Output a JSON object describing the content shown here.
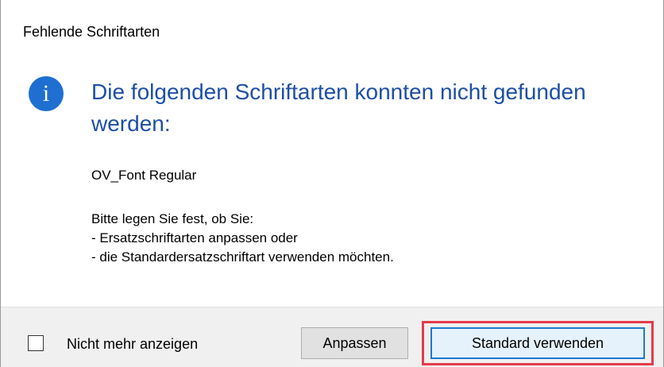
{
  "dialog": {
    "title": "Fehlende Schriftarten",
    "icon": "info-icon",
    "icon_glyph": "i",
    "headline": "Die folgenden Schriftarten konnten nicht gefunden werden:",
    "font_name": "OV_Font Regular",
    "instructions": [
      "Bitte legen Sie fest, ob Sie:",
      "- Ersatzschriftarten anpassen oder",
      "- die Standardersatzschriftart verwenden möchten."
    ]
  },
  "footer": {
    "checkbox_label": "Nicht mehr anzeigen",
    "checkbox_checked": false,
    "buttons": {
      "anpassen": "Anpassen",
      "standard": "Standard verwenden"
    }
  },
  "colors": {
    "accent": "#1f6fd1",
    "headline": "#1e4fa6",
    "highlight": "#e33b4a"
  }
}
